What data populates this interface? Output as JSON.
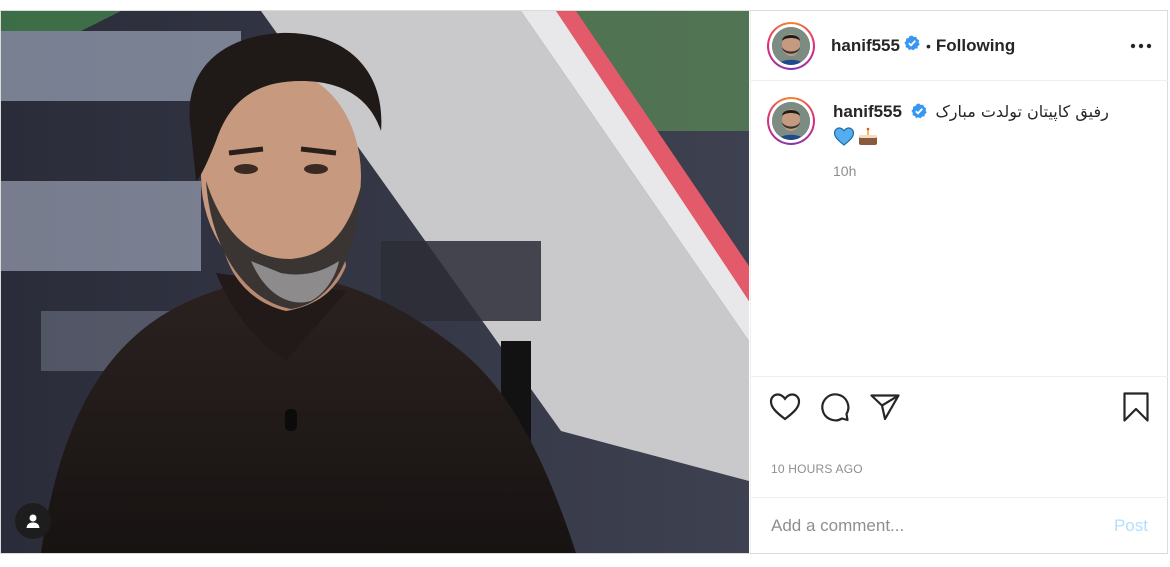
{
  "post": {
    "username": "hanif555",
    "follow_status": "Following",
    "separator": "•",
    "caption": "رفیق کاپیتان تولدت مبارک",
    "caption_emojis": [
      "blue-heart-icon",
      "cake-icon"
    ],
    "time_ago": "10h",
    "date_label": "10 HOURS AGO"
  },
  "comment": {
    "placeholder": "Add a comment...",
    "post_label": "Post"
  },
  "colors": {
    "verified": "#3897f0",
    "post_button": "#b2dffc",
    "muted_text": "#8e8e8e",
    "border": "#dbdbdb"
  }
}
